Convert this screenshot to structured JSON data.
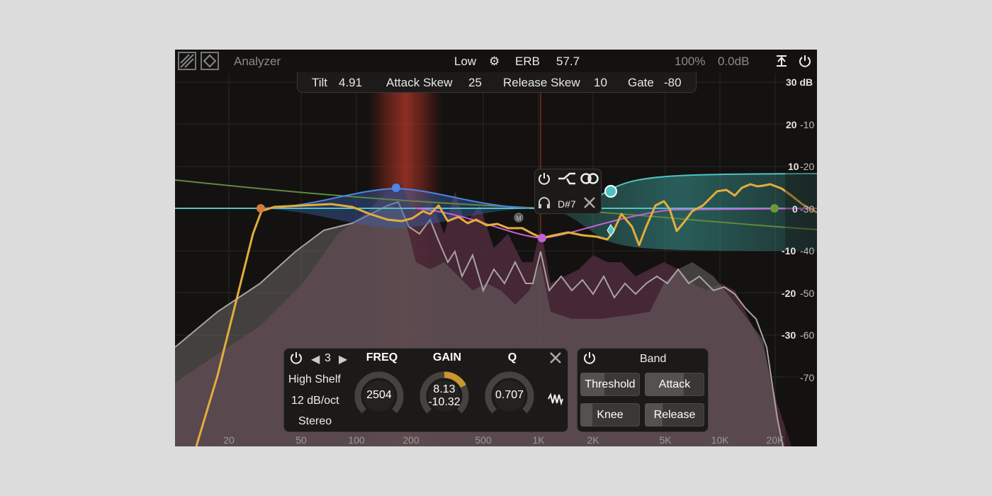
{
  "header": {
    "mode_label": "Analyzer",
    "resolution": "Low",
    "scale": "ERB",
    "scale_value": "57.7",
    "zoom": "100%",
    "output_gain": "0.0dB"
  },
  "params": {
    "tilt_label": "Tilt",
    "tilt_value": "4.91",
    "attack_skew_label": "Attack Skew",
    "attack_skew_value": "25",
    "release_skew_label": "Release Skew",
    "release_skew_value": "10",
    "gate_label": "Gate",
    "gate_value": "-80"
  },
  "axis": {
    "db_left": [
      "30 dB",
      "20",
      "10",
      "0",
      "-10",
      "-20",
      "-30"
    ],
    "db_right": [
      "-10",
      "-20",
      "-30",
      "-40",
      "-50",
      "-60",
      "-70"
    ],
    "freq": [
      "20",
      "50",
      "100",
      "200",
      "500",
      "1K",
      "2K",
      "5K",
      "10K",
      "20K"
    ]
  },
  "band_popup": {
    "note": "D#7"
  },
  "band_panel": {
    "band_number": "3",
    "filter_type": "High Shelf",
    "slope": "12 dB/oct",
    "channel": "Stereo",
    "freq_label": "FREQ",
    "freq_value": "2504",
    "gain_label": "GAIN",
    "gain_value": "8.13",
    "gain_dynamic": "-10.32",
    "q_label": "Q",
    "q_value": "0.707"
  },
  "dynamics_panel": {
    "title": "Band",
    "threshold_label": "Threshold",
    "attack_label": "Attack",
    "knee_label": "Knee",
    "release_label": "Release"
  },
  "colors": {
    "accent_gold": "#e4ad3c",
    "band_teal": "#4fc3c4",
    "band_blue": "#4a86e8",
    "band_purple": "#c65fd8",
    "band_orange": "#d47a3a",
    "band_green": "#6a9a3a",
    "spectrum_pink": "#4a2a3a",
    "solo_red": "#b8342a"
  }
}
